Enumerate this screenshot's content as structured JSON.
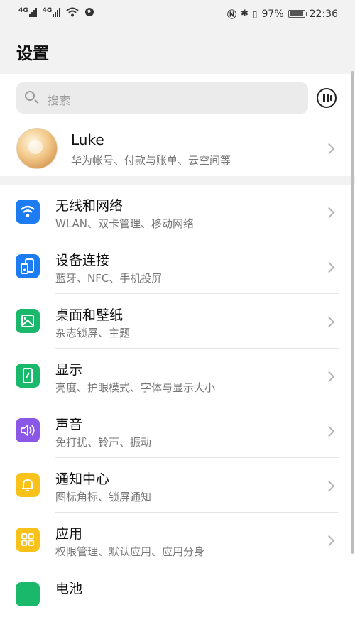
{
  "status_bar": {
    "network1": "4G",
    "network2": "4G",
    "battery": "97%",
    "time": "22:36"
  },
  "page": {
    "title": "设置"
  },
  "search": {
    "placeholder": "搜索"
  },
  "profile": {
    "name": "Luke",
    "subtitle": "华为帐号、付款与账单、云空间等"
  },
  "items": [
    {
      "title": "无线和网络",
      "subtitle": "WLAN、双卡管理、移动网络",
      "icon": "wifi-icon",
      "color": "#1e7cf2"
    },
    {
      "title": "设备连接",
      "subtitle": "蓝牙、NFC、手机投屏",
      "icon": "device-connection-icon",
      "color": "#1e7cf2"
    },
    {
      "title": "桌面和壁纸",
      "subtitle": "杂志锁屏、主题",
      "icon": "wallpaper-icon",
      "color": "#19b86a"
    },
    {
      "title": "显示",
      "subtitle": "亮度、护眼模式、字体与显示大小",
      "icon": "display-icon",
      "color": "#19b86a"
    },
    {
      "title": "声音",
      "subtitle": "免打扰、铃声、振动",
      "icon": "sound-icon",
      "color": "#8a57e6"
    },
    {
      "title": "通知中心",
      "subtitle": "图标角标、锁屏通知",
      "icon": "bell-icon",
      "color": "#f8c21a"
    },
    {
      "title": "应用",
      "subtitle": "权限管理、默认应用、应用分身",
      "icon": "apps-icon",
      "color": "#f8c21a"
    },
    {
      "title": "电池",
      "subtitle": "",
      "icon": "battery-icon",
      "color": "#19b86a"
    }
  ]
}
